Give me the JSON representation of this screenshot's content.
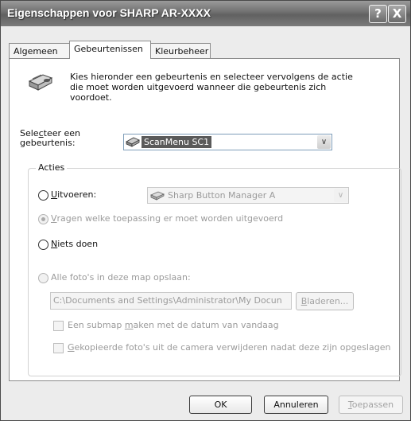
{
  "window": {
    "title": "Eigenschappen voor SHARP AR-XXXX",
    "help_glyph": "?",
    "close_glyph": "X"
  },
  "tabs": [
    {
      "label": "Algemeen"
    },
    {
      "label": "Gebeurtenissen"
    },
    {
      "label": "Kleurbeheer"
    }
  ],
  "intro": {
    "line1": "Kies hieronder een gebeurtenis en selecteer vervolgens de actie",
    "line2": "die moet worden uitgevoerd wanneer die gebeurtenis zich",
    "line3": "voordoet."
  },
  "event_select": {
    "label_pre": "Sele",
    "label_accel": "c",
    "label_post": "teer een",
    "label_line2": "gebeurtenis:",
    "value": "ScanMenu SC1"
  },
  "actions": {
    "legend": "Acties",
    "run": {
      "accel": "U",
      "rest": "itvoeren:"
    },
    "app_value": "Sharp Button Manager A",
    "ask": {
      "accel": "V",
      "rest": "ragen welke toepassing er moet worden uitgevoerd"
    },
    "nothing": {
      "accel": "N",
      "rest": "iets doen"
    },
    "save_all": "Alle foto's in deze map opslaan:",
    "folder_value": "C:\\Documents and Settings\\Administrator\\My Docun",
    "browse": {
      "accel": "B",
      "rest": "laderen..."
    },
    "submap": {
      "pre": "Een submap ",
      "accel": "m",
      "rest": "aken met de datum van vandaag"
    },
    "delete": {
      "accel": "G",
      "rest": "ekopieerde foto's uit de camera verwijderen nadat deze zijn opgeslagen"
    }
  },
  "buttons": {
    "ok": "OK",
    "cancel": "Annuleren",
    "apply": {
      "accel": "T",
      "rest": "oepassen"
    }
  }
}
